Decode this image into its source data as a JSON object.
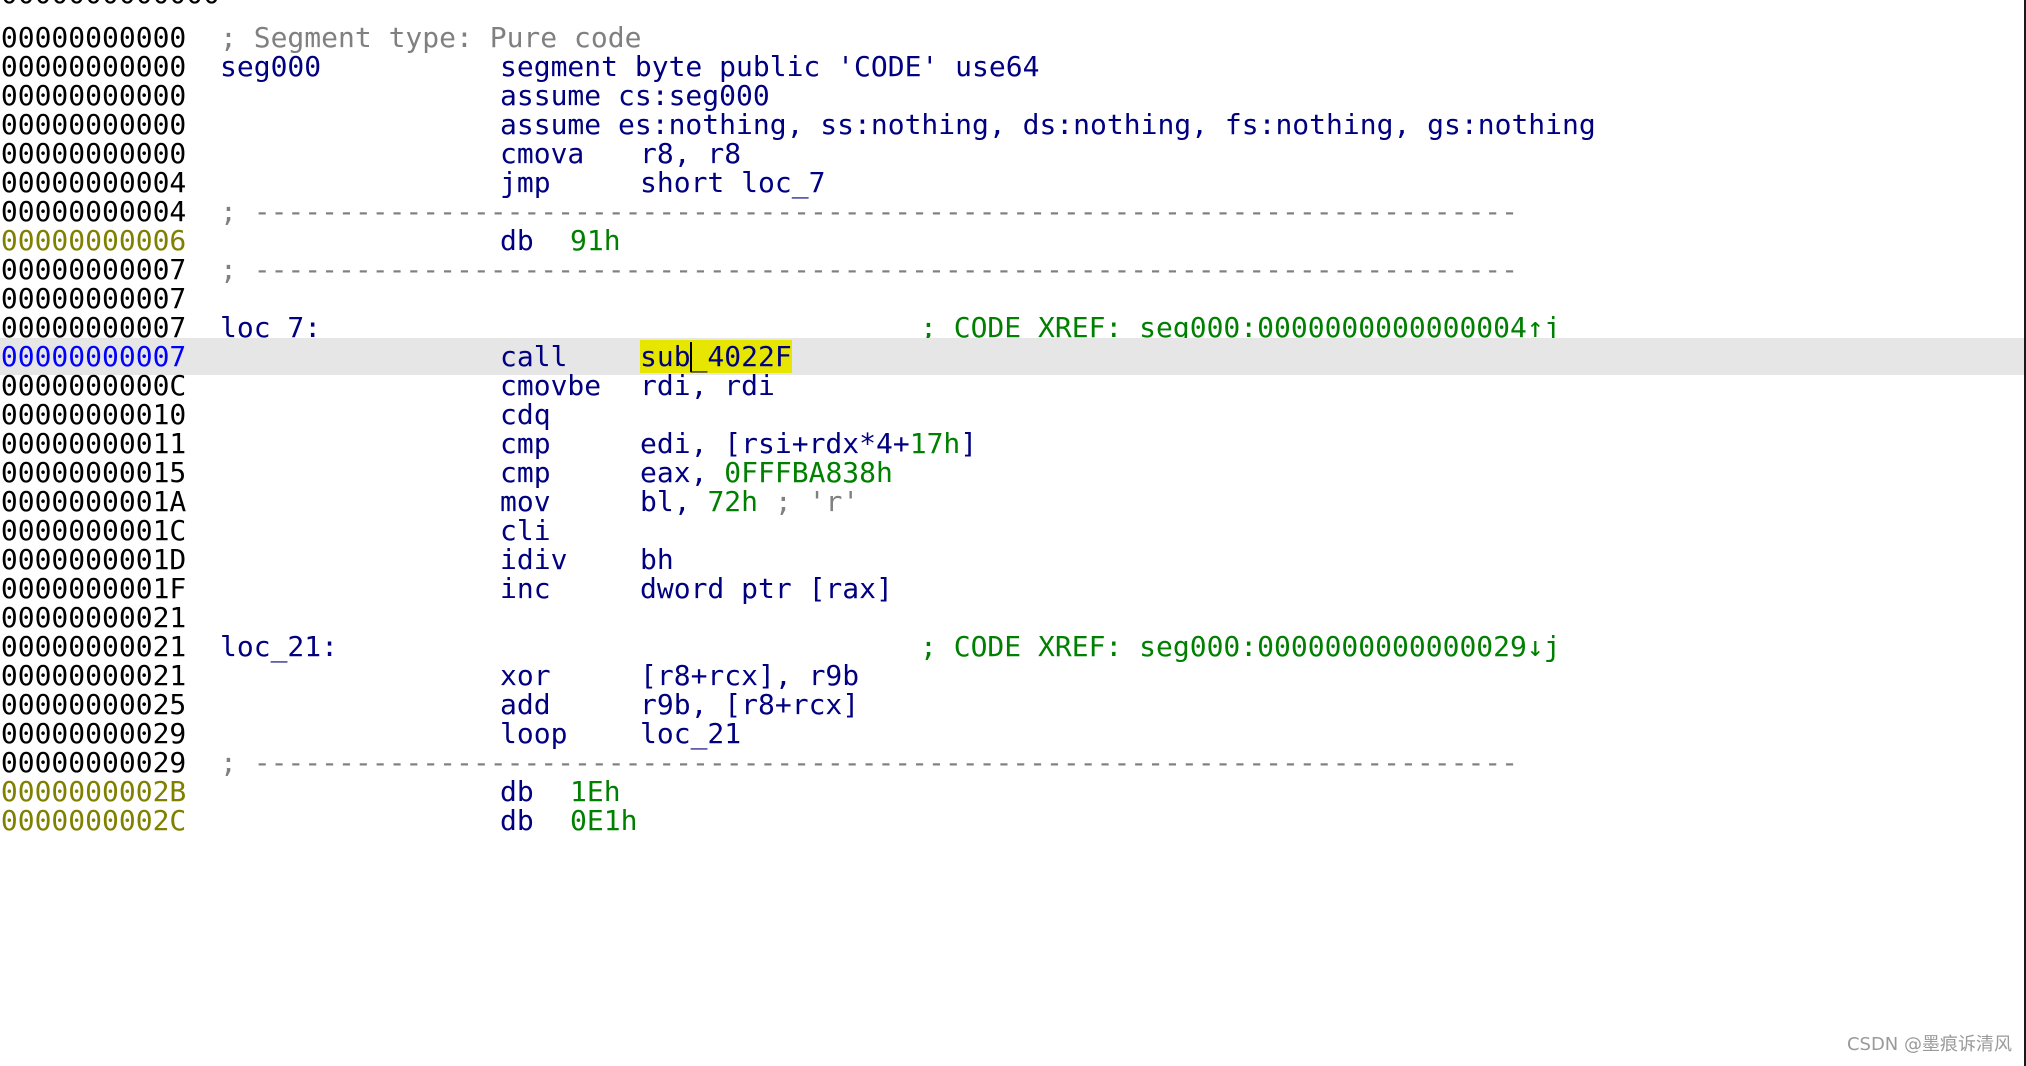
{
  "colors": {
    "background": "#ffffff",
    "current_line": "#e6e6e6",
    "highlight": "#e6e600",
    "code_text": "#000080",
    "comment": "#808080",
    "xref": "#008000",
    "data_address": "#808000"
  },
  "listing": {
    "top_partial_address": "00000000000000",
    "segment_comment": "; Segment type: Pure code",
    "segment_label": "seg000",
    "segment_directive": "segment byte public 'CODE' use64",
    "assume1": "assume cs:seg000",
    "assume2": "assume es:nothing, ss:nothing, ds:nothing, fs:nothing, gs:nothing",
    "separator": "; ---------------------------------------------------------------------------",
    "lines": [
      {
        "addr": "000000000000",
        "kind": "comment"
      },
      {
        "addr": "000000000000",
        "kind": "segment"
      },
      {
        "addr": "000000000000",
        "kind": "assume1"
      },
      {
        "addr": "000000000000",
        "kind": "assume2"
      },
      {
        "addr": "000000000000",
        "mnem": "cmova",
        "ops": "r8, r8"
      },
      {
        "addr": "000000000004",
        "mnem": "jmp",
        "ops": "short loc_7"
      },
      {
        "addr": "000000000004",
        "kind": "separator"
      },
      {
        "addr": "000000000006",
        "kind": "db",
        "mnem": "db",
        "value": "91h"
      },
      {
        "addr": "000000000007",
        "kind": "separator"
      },
      {
        "addr": "000000000007",
        "kind": "blank"
      },
      {
        "addr": "000000000007",
        "kind": "label",
        "label": "loc_7:",
        "xref": "; CODE XREF: seg000:0000000000000004↑j"
      },
      {
        "addr": "000000000007",
        "kind": "current",
        "mnem": "call",
        "ops_before": "sub",
        "ops_after": "_4022F"
      },
      {
        "addr": "00000000000C",
        "mnem": "cmovbe",
        "ops": "rdi, rdi"
      },
      {
        "addr": "000000000010",
        "mnem": "cdq",
        "ops": ""
      },
      {
        "addr": "000000000011",
        "mnem": "cmp",
        "ops_pre": "edi, [rsi+rdx*4+",
        "ops_num": "17h",
        "ops_post": "]"
      },
      {
        "addr": "000000000015",
        "mnem": "cmp",
        "ops_pre": "eax, ",
        "ops_num": "0FFFBA838h",
        "ops_post": ""
      },
      {
        "addr": "00000000001A",
        "mnem": "mov",
        "ops_pre": "bl, ",
        "ops_num": "72h",
        "ops_cmt": " ; 'r'"
      },
      {
        "addr": "00000000001C",
        "mnem": "cli",
        "ops": ""
      },
      {
        "addr": "00000000001D",
        "mnem": "idiv",
        "ops": "bh"
      },
      {
        "addr": "00000000001F",
        "mnem": "inc",
        "ops": "dword ptr [rax]"
      },
      {
        "addr": "000000000021",
        "kind": "blank"
      },
      {
        "addr": "000000000021",
        "kind": "label",
        "label": "loc_21:",
        "xref": "; CODE XREF: seg000:0000000000000029↓j"
      },
      {
        "addr": "000000000021",
        "mnem": "xor",
        "ops": "[r8+rcx], r9b"
      },
      {
        "addr": "000000000025",
        "mnem": "add",
        "ops": "r9b, [r8+rcx]"
      },
      {
        "addr": "000000000029",
        "mnem": "loop",
        "ops": "loc_21"
      },
      {
        "addr": "000000000029",
        "kind": "separator"
      },
      {
        "addr": "00000000002B",
        "kind": "db",
        "mnem": "db",
        "value": "1Eh"
      },
      {
        "addr": "00000000002C",
        "kind": "db",
        "mnem": "db",
        "value": "0E1h"
      }
    ]
  },
  "watermark": "CSDN @墨痕诉清风"
}
